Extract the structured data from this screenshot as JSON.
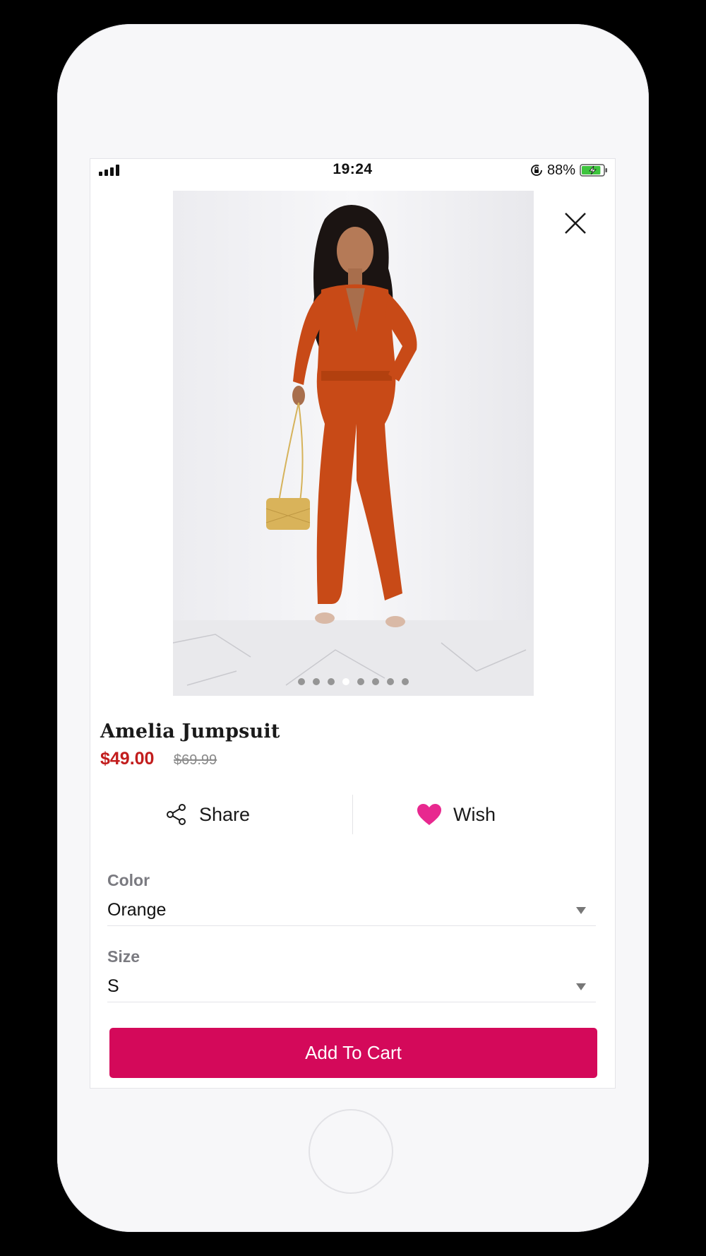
{
  "status_bar": {
    "time": "19:24",
    "battery_percent": "88%",
    "signal_bars": 4,
    "battery_level": 0.88,
    "battery_color": "#3ec43e",
    "icons": [
      "signal-icon",
      "rotation-lock-icon",
      "battery-charging-icon"
    ]
  },
  "product": {
    "name": "Amelia Jumpsuit",
    "price": "$49.00",
    "original_price": "$69.99",
    "price_color": "#c21d1d",
    "image_count": 8,
    "active_image_index": 3
  },
  "actions": {
    "share_label": "Share",
    "wish_label": "Wish",
    "share_icon": "share-icon",
    "wish_icon": "heart-icon",
    "wish_color": "#e8288f"
  },
  "options": {
    "color_label": "Color",
    "color_value": "Orange",
    "size_label": "Size",
    "size_value": "S"
  },
  "cart": {
    "label": "Add To Cart",
    "color": "#d4095a"
  }
}
